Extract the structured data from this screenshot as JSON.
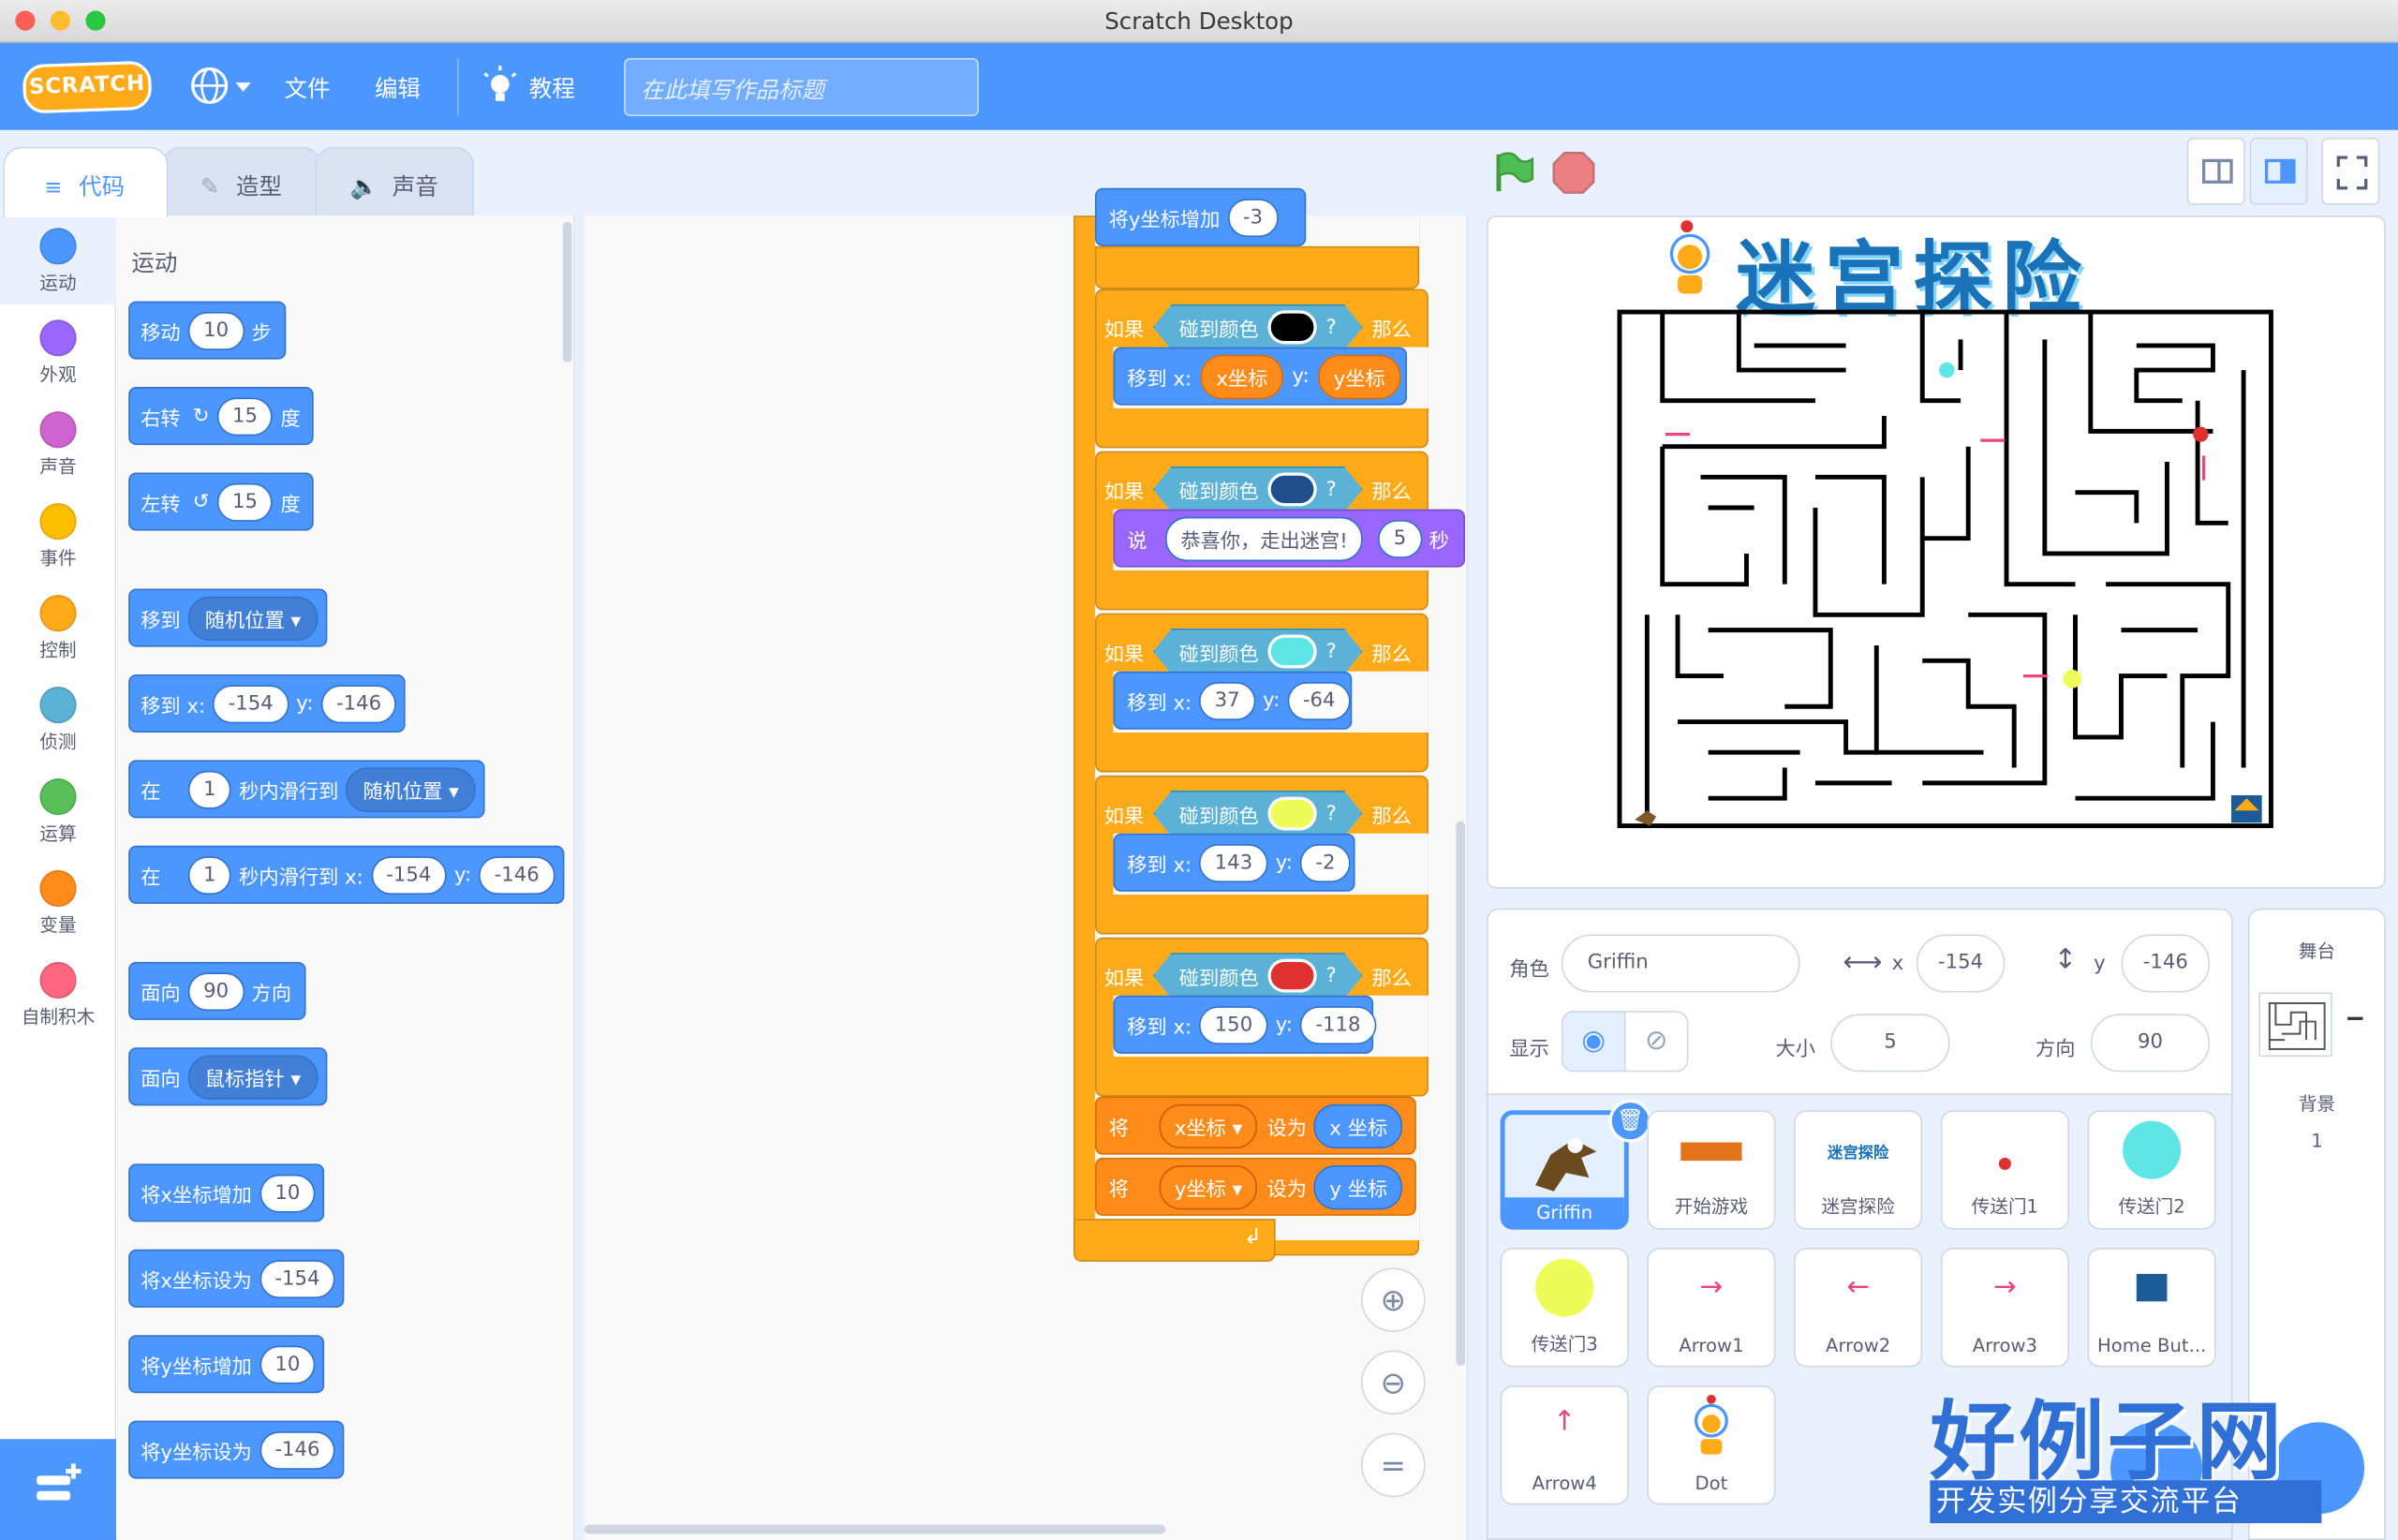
{
  "window": {
    "title": "Scratch Desktop"
  },
  "menubar": {
    "logo": "SCRATCH",
    "file": "文件",
    "edit": "编辑",
    "tutorials": "教程",
    "title_placeholder": "在此填写作品标题"
  },
  "tabs": {
    "code": "代码",
    "costumes": "造型",
    "sounds": "声音"
  },
  "categories": [
    {
      "label": "运动",
      "color": "#4c97ff"
    },
    {
      "label": "外观",
      "color": "#9966ff"
    },
    {
      "label": "声音",
      "color": "#cf63cf"
    },
    {
      "label": "事件",
      "color": "#ffbf00"
    },
    {
      "label": "控制",
      "color": "#ffab19"
    },
    {
      "label": "侦测",
      "color": "#5cb1d6"
    },
    {
      "label": "运算",
      "color": "#59c059"
    },
    {
      "label": "变量",
      "color": "#ff8c1a"
    },
    {
      "label": "自制积木",
      "color": "#ff6680"
    }
  ],
  "palette": {
    "heading": "运动",
    "move": {
      "pre": "移动",
      "val": "10",
      "post": "步"
    },
    "turn_right": {
      "pre": "右转",
      "val": "15",
      "post": "度"
    },
    "turn_left": {
      "pre": "左转",
      "val": "15",
      "post": "度"
    },
    "goto": {
      "pre": "移到",
      "dd": "随机位置"
    },
    "goto_xy": {
      "pre": "移到 x:",
      "x": "-154",
      "ylbl": "y:",
      "y": "-146"
    },
    "glide": {
      "pre": "在",
      "val": "1",
      "mid": "秒内滑行到",
      "dd": "随机位置"
    },
    "glide_xy": {
      "pre": "在",
      "val": "1",
      "mid": "秒内滑行到 x:",
      "x": "-154",
      "ylbl": "y:",
      "y": "-146"
    },
    "point_dir": {
      "pre": "面向",
      "val": "90",
      "post": "方向"
    },
    "point_towards": {
      "pre": "面向",
      "dd": "鼠标指针"
    },
    "change_x": {
      "pre": "将x坐标增加",
      "val": "10"
    },
    "set_x": {
      "pre": "将x坐标设为",
      "val": "-154"
    },
    "change_y": {
      "pre": "将y坐标增加",
      "val": "10"
    },
    "set_y": {
      "pre": "将y坐标设为",
      "val": "-146"
    }
  },
  "script": {
    "top": {
      "label": "将y坐标增加",
      "val": "-3"
    },
    "if_label": "如果",
    "touch_color": "碰到颜色",
    "q": "?",
    "then": "那么",
    "goto_x": "移到 x:",
    "y_lbl": "y:",
    "ifs": [
      {
        "color": "#000000",
        "x": "x坐标",
        "y": "y坐标",
        "x_reporter": true
      },
      {
        "color": "#1f4e8c",
        "say": "说",
        "say_text": "恭喜你，走出迷宫!",
        "say_secs": "5",
        "say_unit": "秒"
      },
      {
        "color": "#5ee6e6",
        "x": "37",
        "y": "-64"
      },
      {
        "color": "#eefc58",
        "x": "143",
        "y": "-2"
      },
      {
        "color": "#e03131",
        "x": "150",
        "y": "-118"
      }
    ],
    "set_var_pre": "将",
    "set_var_mid": "设为",
    "vars": [
      {
        "dd": "x坐标",
        "reporter": "x 坐标"
      },
      {
        "dd": "y坐标",
        "reporter": "y 坐标"
      }
    ]
  },
  "stage": {
    "title": "迷宫探险"
  },
  "sprite_info": {
    "sprite_label": "角色",
    "sprite_name": "Griffin",
    "x_label": "x",
    "x": "-154",
    "y_label": "y",
    "y": "-146",
    "show_label": "显示",
    "size_label": "大小",
    "size": "5",
    "direction_label": "方向",
    "direction": "90"
  },
  "sprites": [
    {
      "name": "Griffin",
      "selected": true
    },
    {
      "name": "开始游戏"
    },
    {
      "name": "迷宫探险"
    },
    {
      "name": "传送门1"
    },
    {
      "name": "传送门2"
    },
    {
      "name": "传送门3"
    },
    {
      "name": "Arrow1"
    },
    {
      "name": "Arrow2"
    },
    {
      "name": "Arrow3"
    },
    {
      "name": "Home But..."
    },
    {
      "name": "Arrow4"
    },
    {
      "name": "Dot"
    }
  ],
  "stage_panel": {
    "title": "舞台",
    "backdrop_label": "背景",
    "backdrop_count": "1"
  },
  "watermark": {
    "brand": "好例子网",
    "slogan": "开发实例分享交流平台"
  }
}
